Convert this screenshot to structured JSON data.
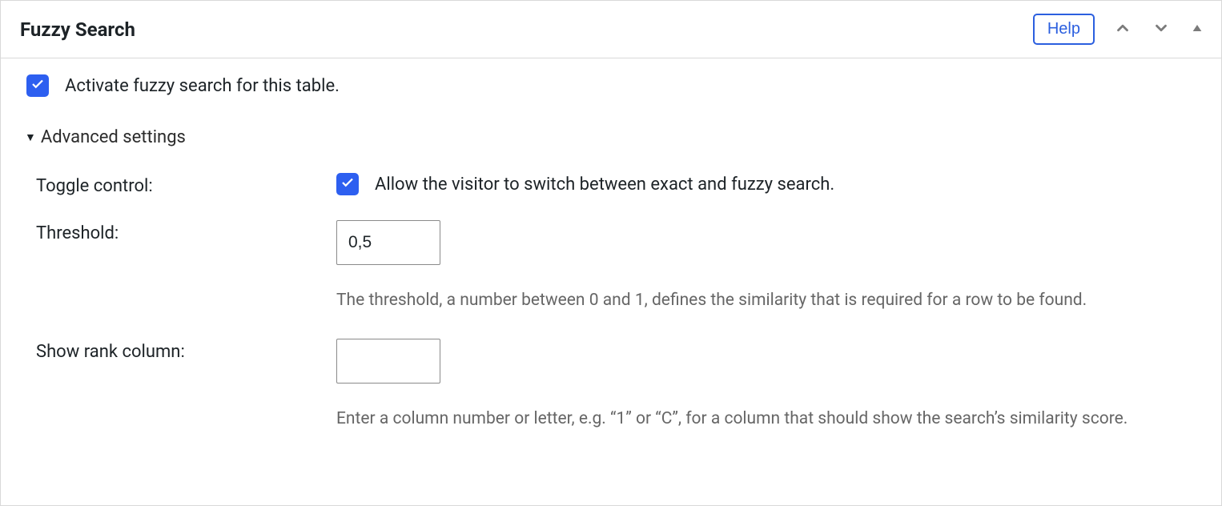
{
  "panel": {
    "title": "Fuzzy Search",
    "help_label": "Help"
  },
  "activate": {
    "label": "Activate fuzzy search for this table.",
    "checked": true
  },
  "advanced": {
    "label": "Advanced settings",
    "expanded": true
  },
  "settings": {
    "toggle_control": {
      "label": "Toggle control:",
      "checked": true,
      "description": "Allow the visitor to switch between exact and fuzzy search."
    },
    "threshold": {
      "label": "Threshold:",
      "value": "0,5",
      "help": "The threshold, a number between 0 and 1, defines the similarity that is required for a row to be found."
    },
    "rank_column": {
      "label": "Show rank column:",
      "value": "",
      "help": "Enter a column number or letter, e.g. “1” or “C”, for a column that should show the search’s similarity score."
    }
  }
}
